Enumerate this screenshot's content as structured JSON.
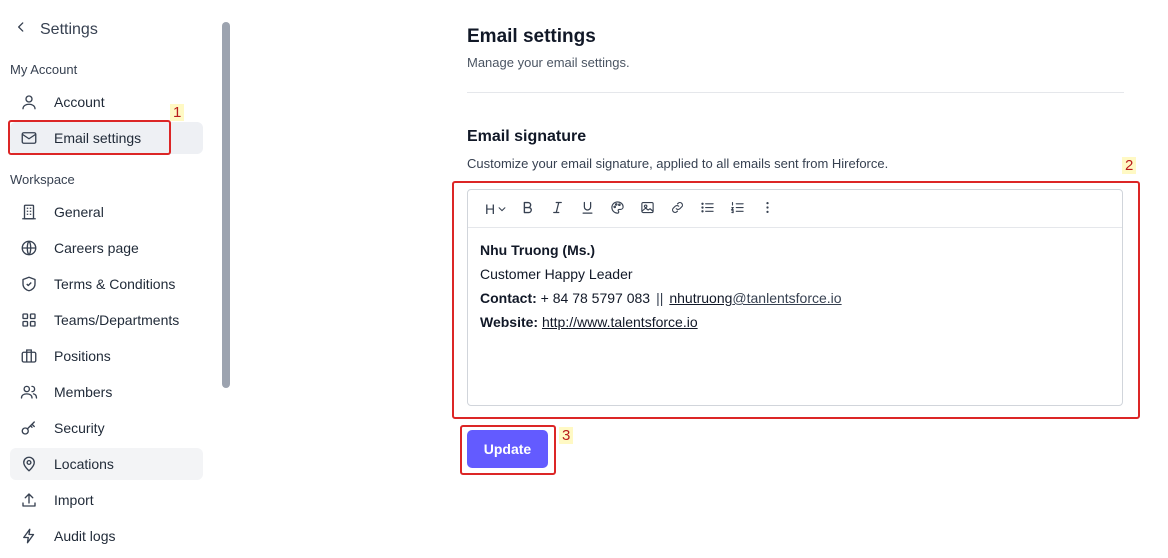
{
  "sidebar": {
    "back_title": "Settings",
    "section_my_account": "My Account",
    "section_workspace": "Workspace",
    "items": [
      {
        "label": "Account",
        "icon": "user-icon"
      },
      {
        "label": "Email settings",
        "icon": "mail-icon"
      },
      {
        "label": "General",
        "icon": "building-icon"
      },
      {
        "label": "Careers page",
        "icon": "globe-icon"
      },
      {
        "label": "Terms & Conditions",
        "icon": "shield-check-icon"
      },
      {
        "label": "Teams/Departments",
        "icon": "grid-icon"
      },
      {
        "label": "Positions",
        "icon": "briefcase-icon"
      },
      {
        "label": "Members",
        "icon": "users-icon"
      },
      {
        "label": "Security",
        "icon": "key-icon"
      },
      {
        "label": "Locations",
        "icon": "map-pin-icon"
      },
      {
        "label": "Import",
        "icon": "upload-icon"
      },
      {
        "label": "Audit logs",
        "icon": "bolt-icon"
      }
    ]
  },
  "annotations": {
    "one": "1",
    "two": "2",
    "three": "3"
  },
  "main": {
    "title": "Email settings",
    "subtitle": "Manage your email settings.",
    "signature_title": "Email signature",
    "signature_subtitle": "Customize your email signature, applied to all emails sent from Hireforce.",
    "toolbar": {
      "heading": "H"
    },
    "signature": {
      "name": "Nhu Truong (Ms.)",
      "role": "Customer Happy Leader",
      "contact_label": "Contact:",
      "contact_phone": " + 84 78 5797 083",
      "contact_sep": "||",
      "email_user": "nhutruong",
      "email_domain": "@tanlentsforce.io ",
      "website_label": "Website:",
      "website_url": "http://www.talentsforce.io"
    },
    "update_label": "Update"
  },
  "colors": {
    "accent": "#635bff",
    "annotation": "#dc2626"
  }
}
